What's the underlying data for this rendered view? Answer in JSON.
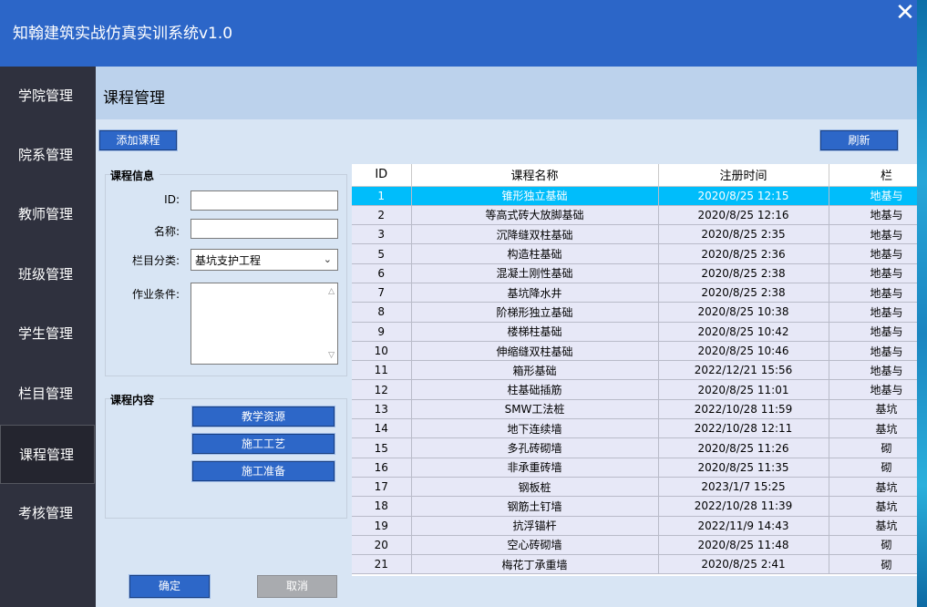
{
  "app_title": "知翰建筑实战仿真实训系统v1.0",
  "close_glyph": "✕",
  "sidebar": [
    {
      "label": "学院管理"
    },
    {
      "label": "院系管理"
    },
    {
      "label": "教师管理"
    },
    {
      "label": "班级管理"
    },
    {
      "label": "学生管理"
    },
    {
      "label": "栏目管理"
    },
    {
      "label": "课程管理",
      "active": true
    },
    {
      "label": "考核管理"
    }
  ],
  "page_title": "课程管理",
  "toolbar": {
    "add_label": "添加课程",
    "refresh_label": "刷新"
  },
  "form": {
    "group_title": "课程信息",
    "id_label": "ID:",
    "id_value": "",
    "name_label": "名称:",
    "name_value": "",
    "category_label": "栏目分类:",
    "category_value": "基坑支护工程",
    "condition_label": "作业条件:",
    "condition_value": ""
  },
  "content": {
    "group_title": "课程内容",
    "buttons": [
      "教学资源",
      "施工工艺",
      "施工准备"
    ]
  },
  "actions": {
    "confirm_label": "确定",
    "cancel_label": "取消"
  },
  "table": {
    "columns": [
      "ID",
      "课程名称",
      "注册时间",
      "栏"
    ],
    "rows": [
      {
        "id": "1",
        "name": "锥形独立基础",
        "time": "2020/8/25 12:15",
        "cat": "地基与",
        "selected": true
      },
      {
        "id": "2",
        "name": "等高式砖大放脚基础",
        "time": "2020/8/25 12:16",
        "cat": "地基与"
      },
      {
        "id": "3",
        "name": "沉降缝双柱基础",
        "time": "2020/8/25 2:35",
        "cat": "地基与"
      },
      {
        "id": "5",
        "name": "构造柱基础",
        "time": "2020/8/25 2:36",
        "cat": "地基与"
      },
      {
        "id": "6",
        "name": "混凝土刚性基础",
        "time": "2020/8/25 2:38",
        "cat": "地基与"
      },
      {
        "id": "7",
        "name": "基坑降水井",
        "time": "2020/8/25 2:38",
        "cat": "地基与"
      },
      {
        "id": "8",
        "name": "阶梯形独立基础",
        "time": "2020/8/25 10:38",
        "cat": "地基与"
      },
      {
        "id": "9",
        "name": "楼梯柱基础",
        "time": "2020/8/25 10:42",
        "cat": "地基与"
      },
      {
        "id": "10",
        "name": "伸缩缝双柱基础",
        "time": "2020/8/25 10:46",
        "cat": "地基与"
      },
      {
        "id": "11",
        "name": "箱形基础",
        "time": "2022/12/21 15:56",
        "cat": "地基与"
      },
      {
        "id": "12",
        "name": "柱基础插筋",
        "time": "2020/8/25 11:01",
        "cat": "地基与"
      },
      {
        "id": "13",
        "name": "SMW工法桩",
        "time": "2022/10/28 11:59",
        "cat": "基坑"
      },
      {
        "id": "14",
        "name": "地下连续墙",
        "time": "2022/10/28 12:11",
        "cat": "基坑"
      },
      {
        "id": "15",
        "name": "多孔砖砌墙",
        "time": "2020/8/25 11:26",
        "cat": "砌"
      },
      {
        "id": "16",
        "name": "非承重砖墙",
        "time": "2020/8/25 11:35",
        "cat": "砌"
      },
      {
        "id": "17",
        "name": "钢板桩",
        "time": "2023/1/7 15:25",
        "cat": "基坑"
      },
      {
        "id": "18",
        "name": "钢筋土钉墙",
        "time": "2022/10/28 11:39",
        "cat": "基坑"
      },
      {
        "id": "19",
        "name": "抗浮锚杆",
        "time": "2022/11/9 14:43",
        "cat": "基坑"
      },
      {
        "id": "20",
        "name": "空心砖砌墙",
        "time": "2020/8/25 11:48",
        "cat": "砌"
      },
      {
        "id": "21",
        "name": "梅花丁承重墙",
        "time": "2020/8/25 2:41",
        "cat": "砌"
      }
    ]
  }
}
